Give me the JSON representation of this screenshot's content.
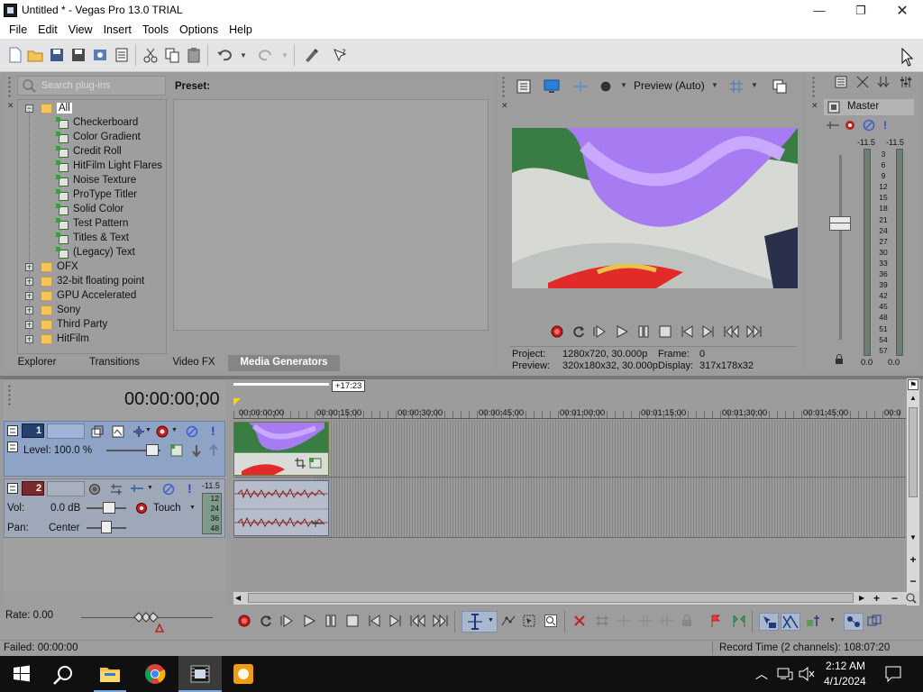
{
  "window": {
    "title": "Untitled * - Vegas Pro 13.0 TRIAL"
  },
  "menu": [
    "File",
    "Edit",
    "View",
    "Insert",
    "Tools",
    "Options",
    "Help"
  ],
  "explorer": {
    "search_placeholder": "Search plug-ins",
    "preset_label": "Preset:",
    "tree": {
      "root": "All",
      "generators": [
        "Checkerboard",
        "Color Gradient",
        "Credit Roll",
        "HitFilm Light Flares",
        "Noise Texture",
        "ProType Titler",
        "Solid Color",
        "Test Pattern",
        "Titles & Text",
        "(Legacy) Text"
      ],
      "folders": [
        "OFX",
        "32-bit floating point",
        "GPU Accelerated",
        "Sony",
        "Third Party",
        "HitFilm"
      ]
    },
    "tabs": [
      "Explorer",
      "Transitions",
      "Video FX",
      "Media Generators"
    ],
    "active_tab": "Media Generators"
  },
  "preview": {
    "quality": "Preview (Auto)",
    "project": "1280x720, 30.000p",
    "preview_res": "320x180x32, 30.000p",
    "frame": "0",
    "display": "317x178x32",
    "labels": {
      "project": "Project:",
      "preview": "Preview:",
      "frame": "Frame:",
      "display": "Display:"
    }
  },
  "master": {
    "title": "Master",
    "peak_left": "-11.5",
    "peak_right": "-11.5",
    "scale": [
      "3",
      "6",
      "9",
      "12",
      "15",
      "18",
      "21",
      "24",
      "27",
      "30",
      "33",
      "36",
      "39",
      "42",
      "45",
      "48",
      "51",
      "54",
      "57"
    ],
    "level_left": "0.0",
    "level_right": "0.0"
  },
  "timeline": {
    "timecode": "00:00:00;00",
    "loop_region": "+17:23",
    "ruler": [
      "00:00:00;00",
      "00:00:15;00",
      "00:00:30;00",
      "00:00:45;00",
      "00:01:00;00",
      "00:01:15;00",
      "00:01:30;00",
      "00:01:45;00",
      "00:0"
    ],
    "video_track": {
      "number": "1",
      "level_label": "Level: 100.0 %"
    },
    "audio_track": {
      "number": "2",
      "vol_label": "Vol:",
      "vol_value": "0.0 dB",
      "pan_label": "Pan:",
      "pan_value": "Center",
      "automation": "Touch",
      "peak": "-11.5",
      "meter_scale": [
        "12",
        "24",
        "36",
        "48"
      ]
    },
    "rate": "Rate: 0.00"
  },
  "status": {
    "left": "Failed: 00:00:00",
    "right": "Record Time (2 channels): 108:07:20"
  },
  "taskbar": {
    "time": "2:12 AM",
    "date": "4/1/2024"
  },
  "colors": {
    "panel": "#9d9d9d",
    "video_track_header": "#8fa3c6",
    "audio_track_header": "#9fa8b8",
    "accent_red": "#c02020"
  }
}
